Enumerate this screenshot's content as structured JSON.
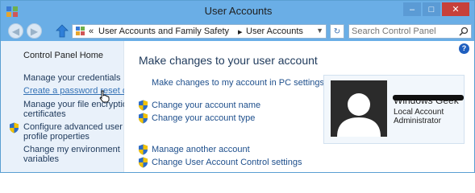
{
  "window": {
    "title": "User Accounts"
  },
  "colors": {
    "titlebar": "#6aaee6",
    "sidebar": "#e9f1fa",
    "link": "#1e4f8c",
    "close_button": "#c7403a"
  },
  "address_bar": {
    "separator": "«",
    "crumbs": [
      "User Accounts and Family Safety",
      "User Accounts"
    ]
  },
  "search": {
    "placeholder": "Search Control Panel"
  },
  "sidebar": {
    "home": "Control Panel Home",
    "links": [
      {
        "label": "Manage your credentials",
        "shield": false
      },
      {
        "label": "Create a password reset disk",
        "shield": false,
        "active": true
      },
      {
        "label_lines": [
          "Manage your file encryption",
          "certificates"
        ],
        "shield": false
      },
      {
        "label_lines": [
          "Configure advanced user",
          "profile properties"
        ],
        "shield": true
      },
      {
        "label_lines": [
          "Change my environment",
          "variables"
        ],
        "shield": false
      }
    ]
  },
  "main": {
    "title": "Make changes to your user account",
    "links": [
      {
        "label": "Make changes to my account in PC settings",
        "shield": false
      },
      {
        "label": "Change your account name",
        "shield": true
      },
      {
        "label": "Change your account type",
        "shield": true
      },
      {
        "label": "Manage another account",
        "shield": true
      },
      {
        "label": "Change User Account Control settings",
        "shield": true
      }
    ]
  },
  "account": {
    "name": "Windows Geek",
    "type": "Local Account",
    "role": "Administrator"
  },
  "icons": [
    "control-panel-icon",
    "minimize-icon",
    "maximize-icon",
    "close-icon",
    "back-icon",
    "forward-icon",
    "up-icon",
    "folder-icon",
    "chevron-down-icon",
    "refresh-icon",
    "search-icon",
    "uac-shield-icon",
    "help-icon",
    "user-silhouette-icon",
    "hand-cursor-icon"
  ]
}
